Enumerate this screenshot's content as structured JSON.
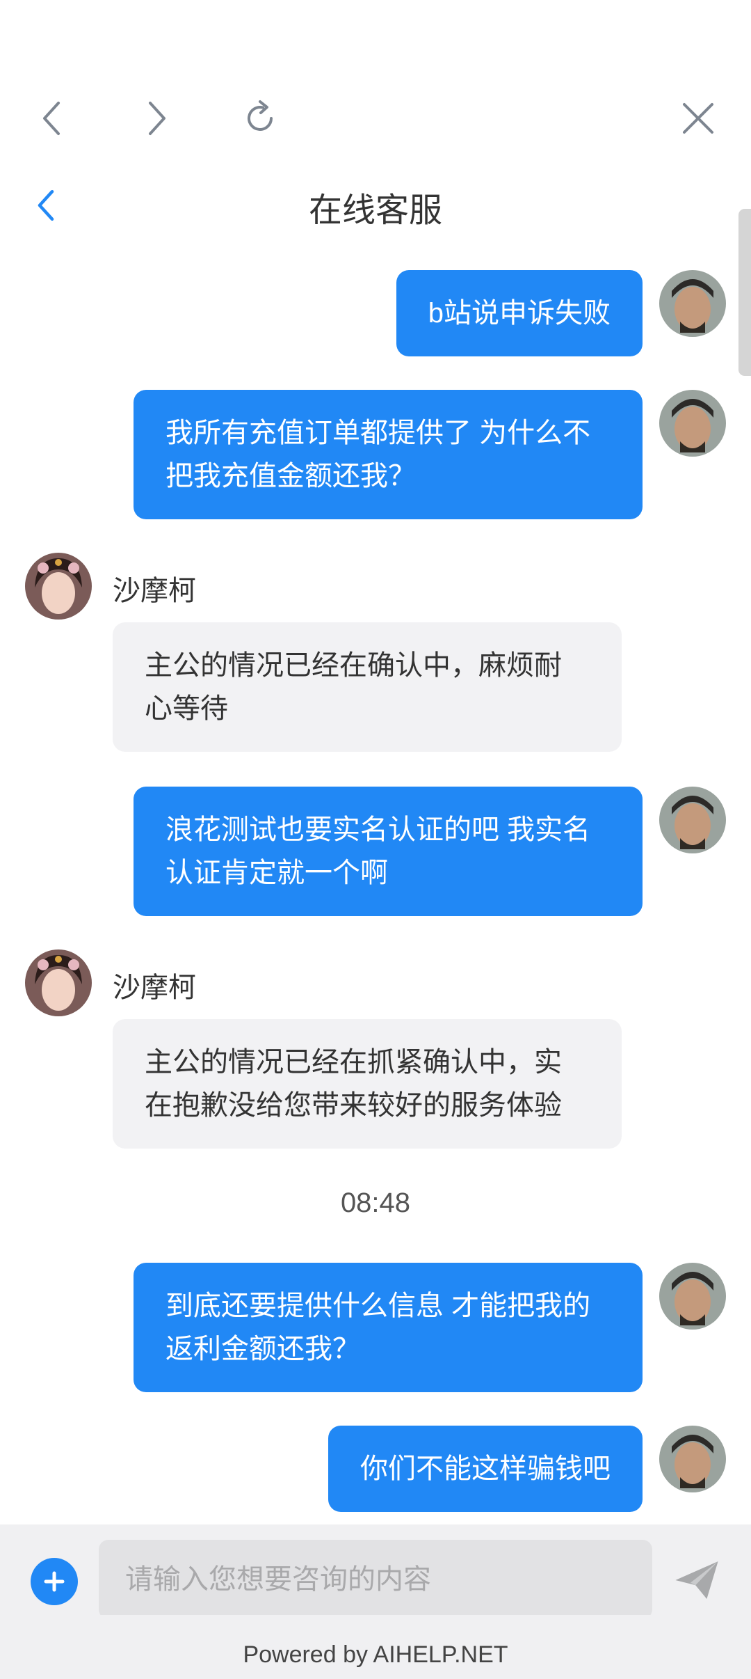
{
  "browser": {
    "back_icon": "chevron-left-icon",
    "forward_icon": "chevron-right-icon",
    "refresh_icon": "refresh-icon",
    "close_icon": "close-icon"
  },
  "header": {
    "title": "在线客服",
    "back_icon": "chevron-left-icon"
  },
  "messages": [
    {
      "sender": "user",
      "lines": [
        "b站说申诉失败"
      ]
    },
    {
      "sender": "user",
      "lines": [
        "我所有充值订单都提供了 为什么不",
        "把我充值金额还我？"
      ]
    },
    {
      "sender": "agent",
      "name": "沙摩柯",
      "lines": [
        "主公的情况已经在确认中，麻烦耐",
        "心等待"
      ]
    },
    {
      "sender": "user",
      "lines": [
        "浪花测试也要实名认证的吧 我实名",
        "认证肯定就一个啊"
      ]
    },
    {
      "sender": "agent",
      "name": "沙摩柯",
      "lines": [
        "主公的情况已经在抓紧确认中，实",
        "在抱歉没给您带来较好的服务体验"
      ]
    },
    {
      "time": "08:48"
    },
    {
      "sender": "user",
      "lines": [
        "到底还要提供什么信息 才能把我的",
        "返利金额还我？"
      ]
    },
    {
      "sender": "user",
      "lines": [
        "你们不能这样骗钱吧"
      ]
    }
  ],
  "input": {
    "placeholder": "请输入您想要咨询的内容",
    "add_icon": "plus-icon",
    "send_icon": "send-icon"
  },
  "footer": {
    "text": "Powered by AIHELP.NET"
  },
  "colors": {
    "accent": "#2188f5",
    "agent_bubble": "#f2f2f4",
    "input_bar": "#f0f0f2"
  }
}
